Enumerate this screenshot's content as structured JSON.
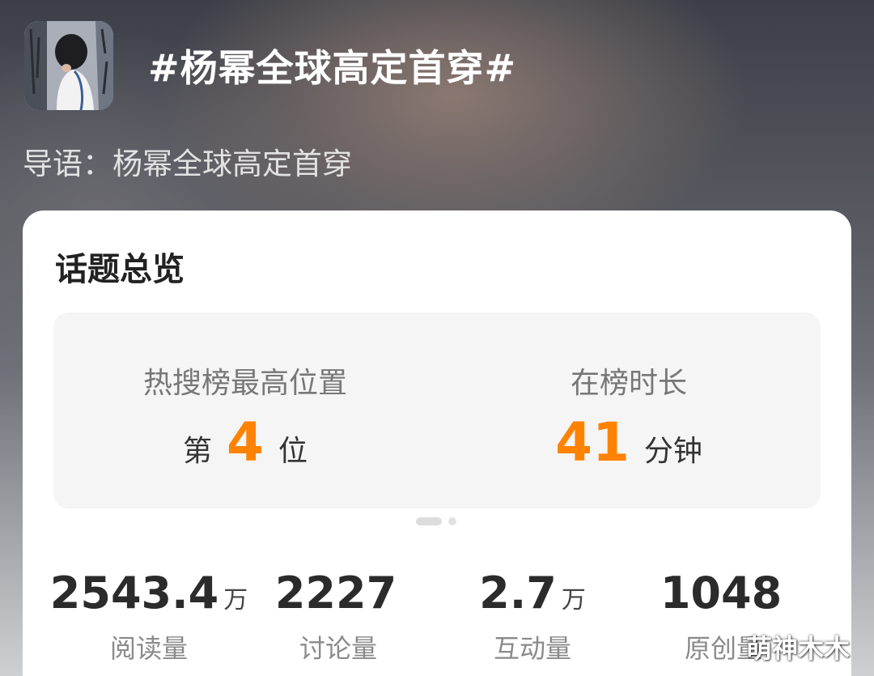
{
  "topic": {
    "title": "#杨幂全球高定首穿#",
    "intro": "导语：杨幂全球高定首穿"
  },
  "overview": {
    "title": "话题总览",
    "peak_rank": {
      "label": "热搜榜最高位置",
      "prefix": "第",
      "value": "4",
      "suffix": "位"
    },
    "duration": {
      "label": "在榜时长",
      "value": "41",
      "unit": "分钟"
    },
    "pager": {
      "pages": 2,
      "current": 1
    }
  },
  "stats": [
    {
      "value": "2543.4",
      "unit": "万",
      "label": "阅读量"
    },
    {
      "value": "2227",
      "unit": "",
      "label": "讨论量"
    },
    {
      "value": "2.7",
      "unit": "万",
      "label": "互动量"
    },
    {
      "value": "1048",
      "unit": "",
      "label": "原创量"
    }
  ],
  "watermark": "萌神木木",
  "colors": {
    "accent": "#ff8200",
    "card": "#ffffff",
    "panel": "#f5f5f5"
  }
}
